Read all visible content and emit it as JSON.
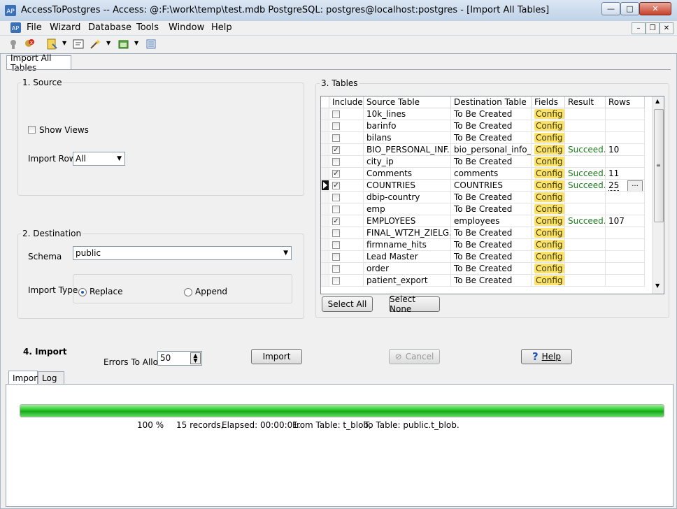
{
  "window": {
    "title": "AccessToPostgres -- Access: @:F:\\work\\temp\\test.mdb PostgreSQL: postgres@localhost:postgres - [Import All Tables]"
  },
  "menu": [
    "File",
    "Wizard",
    "Database",
    "Tools",
    "Window",
    "Help"
  ],
  "toolbar_icons": [
    "connect-icon",
    "disconnect-icon",
    "wizard-icon",
    "dropdown-arrow-icon",
    "query-icon",
    "magic-wand-icon",
    "dropdown-arrow-icon",
    "window-icon",
    "dropdown-arrow-icon",
    "list-icon"
  ],
  "doc_tab": "Import All Tables",
  "source": {
    "label": "1. Source",
    "show_views_label": "Show Views",
    "import_rows_label": "Import Rows",
    "import_rows_value": "All"
  },
  "destination": {
    "label": "2. Destination",
    "schema_label": "Schema",
    "schema_value": "public",
    "import_type_label": "Import Type",
    "replace_label": "Replace",
    "append_label": "Append"
  },
  "tables": {
    "label": "3. Tables",
    "columns": [
      "Include",
      "Source Table",
      "Destination Table",
      "Fields",
      "Result",
      "Rows"
    ],
    "rows": [
      {
        "include": false,
        "source": "10k_lines",
        "dest": "To Be Created",
        "fields": "Config",
        "result": "",
        "rows": ""
      },
      {
        "include": false,
        "source": "barinfo",
        "dest": "To Be Created",
        "fields": "Config",
        "result": "",
        "rows": ""
      },
      {
        "include": false,
        "source": "bilans",
        "dest": "To Be Created",
        "fields": "Config",
        "result": "",
        "rows": ""
      },
      {
        "include": true,
        "source": "BIO_PERSONAL_INF...",
        "dest": "bio_personal_info_t",
        "fields": "Config",
        "result": "Succeed...",
        "rows": "10"
      },
      {
        "include": false,
        "source": "city_ip",
        "dest": "To Be Created",
        "fields": "Config",
        "result": "",
        "rows": ""
      },
      {
        "include": true,
        "source": "Comments",
        "dest": "comments",
        "fields": "Config",
        "result": "Succeed...",
        "rows": "11"
      },
      {
        "include": true,
        "source": "COUNTRIES",
        "dest": "COUNTRIES",
        "fields": "Config",
        "result": "Succeed...",
        "rows": "25",
        "current": true
      },
      {
        "include": false,
        "source": "dbip-country",
        "dest": "To Be Created",
        "fields": "Config",
        "result": "",
        "rows": ""
      },
      {
        "include": false,
        "source": "emp",
        "dest": "To Be Created",
        "fields": "Config",
        "result": "",
        "rows": ""
      },
      {
        "include": true,
        "source": "EMPLOYEES",
        "dest": "employees",
        "fields": "Config",
        "result": "Succeed...",
        "rows": "107"
      },
      {
        "include": false,
        "source": "FINAL_WTZH_ZIELG...",
        "dest": "To Be Created",
        "fields": "Config",
        "result": "",
        "rows": ""
      },
      {
        "include": false,
        "source": "firmname_hits",
        "dest": "To Be Created",
        "fields": "Config",
        "result": "",
        "rows": ""
      },
      {
        "include": false,
        "source": "Lead Master",
        "dest": "To Be Created",
        "fields": "Config",
        "result": "",
        "rows": ""
      },
      {
        "include": false,
        "source": "order",
        "dest": "To Be Created",
        "fields": "Config",
        "result": "",
        "rows": ""
      },
      {
        "include": false,
        "source": "patient_export",
        "dest": "To Be Created",
        "fields": "Config",
        "result": "",
        "rows": ""
      }
    ],
    "ellipsis": "...",
    "select_all": "Select All",
    "select_none": "Select None"
  },
  "import": {
    "label": "4. Import",
    "errors_label": "Errors To Allow",
    "errors_value": "50",
    "import_btn": "Import",
    "cancel_btn": "Cancel",
    "help_btn": "Help"
  },
  "bottom_tabs": [
    "Import",
    "Log"
  ],
  "progress": {
    "fraction": 1.0,
    "percent": "100 %",
    "records": "15 records,",
    "elapsed": "Elapsed: 00:00:01.",
    "from": "From Table: t_blob,",
    "to": "To Table: public.t_blob."
  },
  "colors": {
    "progress": "#23c823",
    "config": "#fde26a",
    "success": "#1d7a1d"
  }
}
